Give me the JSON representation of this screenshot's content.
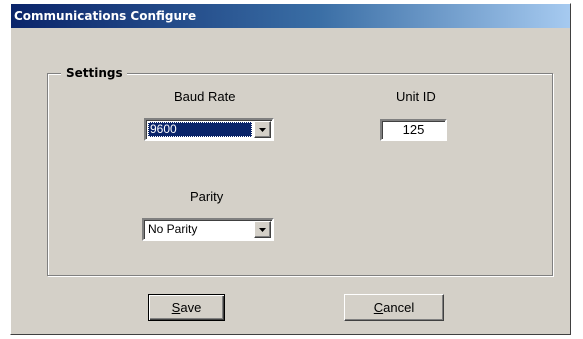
{
  "window": {
    "title": "Communications Configure"
  },
  "settings": {
    "group_label": "Settings",
    "baud_rate": {
      "label": "Baud Rate",
      "value": "9600"
    },
    "unit_id": {
      "label": "Unit ID",
      "value": "125"
    },
    "parity": {
      "label": "Parity",
      "value": "No Parity"
    }
  },
  "buttons": {
    "save": {
      "mnemonic": "S",
      "rest": "ave"
    },
    "cancel": {
      "mnemonic": "C",
      "rest": "ancel"
    }
  },
  "icons": {
    "dropdown": "chevron-down-icon"
  },
  "colors": {
    "dialog_face": "#d4d0c8",
    "titlebar_start": "#0a246a",
    "titlebar_end": "#a6caf0",
    "selection": "#0a246a"
  }
}
